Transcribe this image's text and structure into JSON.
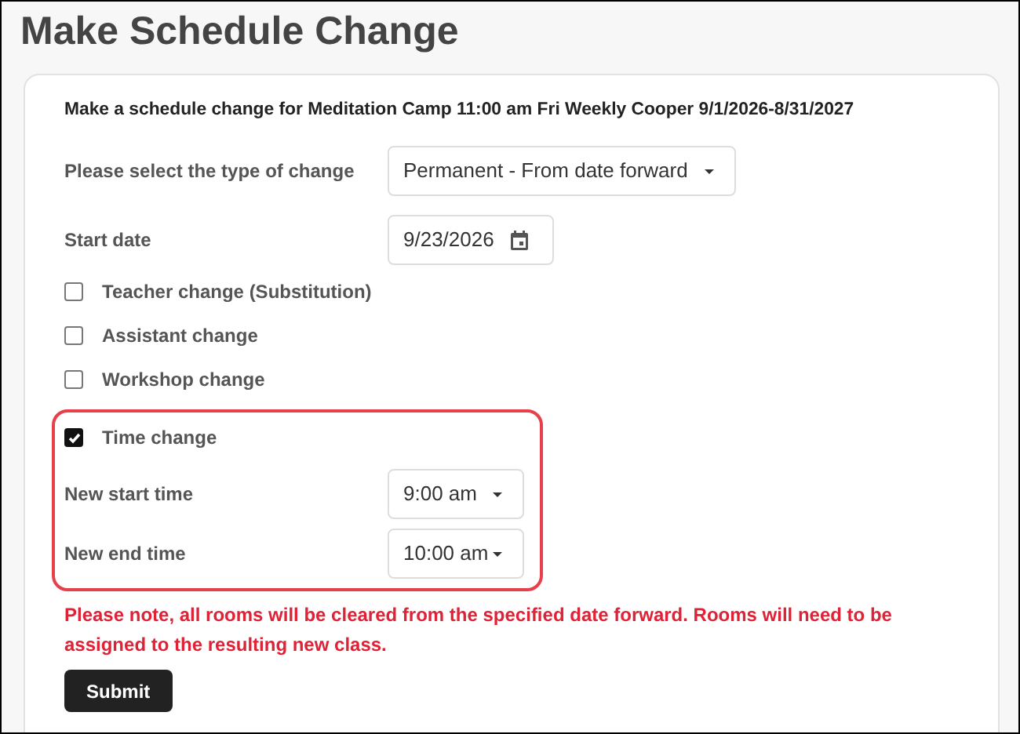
{
  "page_title": "Make Schedule Change",
  "form": {
    "heading": "Make a schedule change for Meditation Camp 11:00 am Fri Weekly Cooper 9/1/2026-8/31/2027",
    "change_type": {
      "label": "Please select the type of change",
      "value": "Permanent - From date forward"
    },
    "start_date": {
      "label": "Start date",
      "value": "9/23/2026"
    },
    "options": [
      {
        "label": "Teacher change (Substitution)",
        "checked": false
      },
      {
        "label": "Assistant change",
        "checked": false
      },
      {
        "label": "Workshop change",
        "checked": false
      },
      {
        "label": "Time change",
        "checked": true
      }
    ],
    "times": [
      {
        "label": "New start time",
        "value": "9:00 am"
      },
      {
        "label": "New end time",
        "value": "10:00 am"
      }
    ],
    "note": "Please note, all rooms will be cleared from the specified date forward. Rooms will need to be assigned to the resulting new class.",
    "submit": "Submit"
  }
}
